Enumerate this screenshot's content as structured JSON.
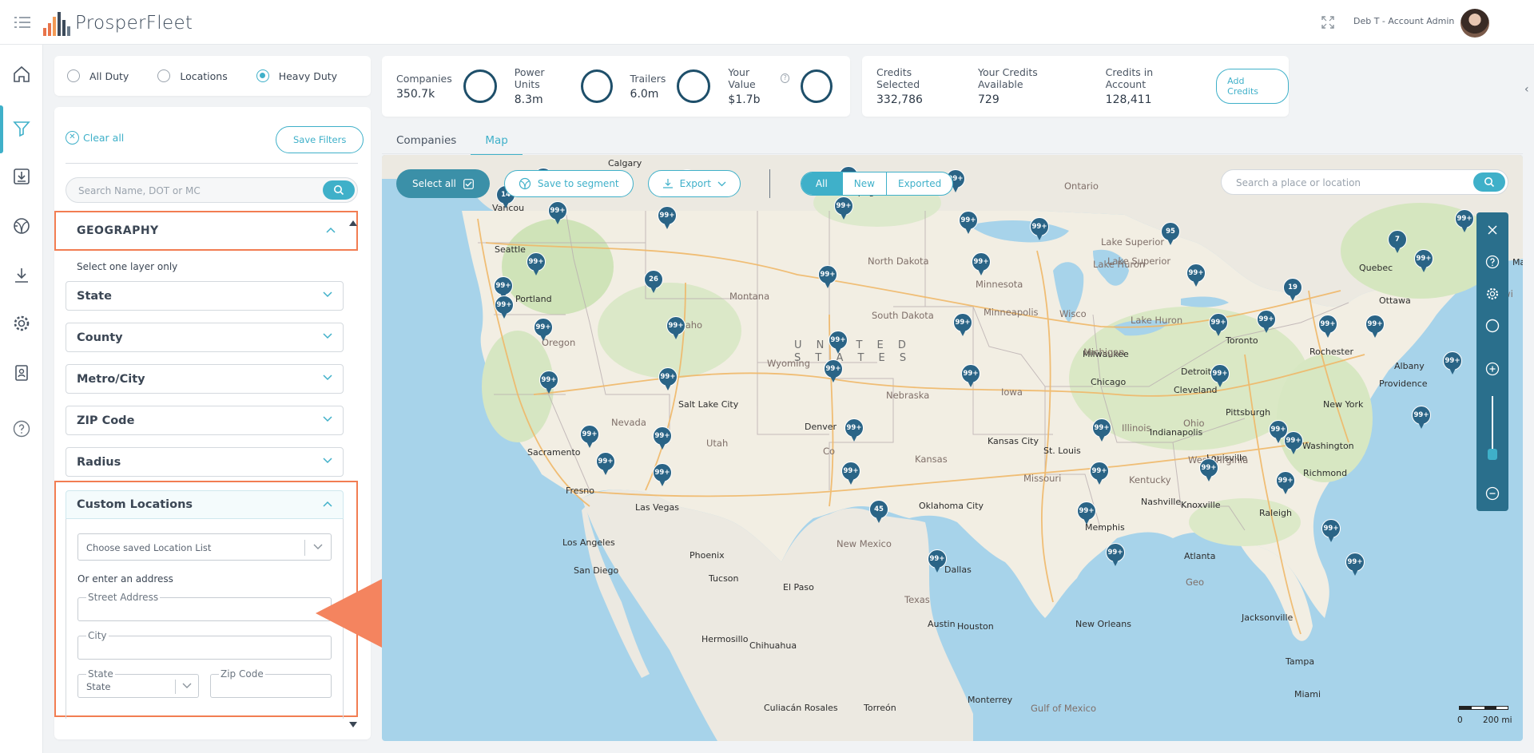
{
  "header": {
    "brand": "ProsperFleet",
    "user": "Deb T - Account Admin",
    "logo_colors": [
      "#e8744a",
      "#e8744a",
      "#f39a55",
      "#3c4a5a",
      "#3c4a5a",
      "#6a7a8a"
    ]
  },
  "duty": {
    "options": [
      "All Duty",
      "Locations",
      "Heavy Duty"
    ],
    "selected": "Heavy Duty"
  },
  "stats": [
    {
      "label": "Companies",
      "value": "350.7k"
    },
    {
      "label": "Power Units",
      "value": "8.3m"
    },
    {
      "label": "Trailers",
      "value": "6.0m"
    },
    {
      "label": "Your Value",
      "value": "$1.7b",
      "help": "?"
    }
  ],
  "credits": {
    "items": [
      {
        "label": "Credits Selected",
        "value": "332,786"
      },
      {
        "label": "Your Credits Available",
        "value": "729"
      },
      {
        "label": "Credits in Account",
        "value": "128,411"
      }
    ],
    "add_label": "Add Credits"
  },
  "filters": {
    "clear_label": "Clear all",
    "clear_icon": "✕",
    "save_label": "Save Filters",
    "search_placeholder": "Search Name, DOT or MC",
    "geography": "GEOGRAPHY",
    "layer_note": "Select one layer only",
    "sections": [
      "State",
      "County",
      "Metro/City",
      "ZIP Code",
      "Radius"
    ],
    "custom": {
      "title": "Custom Locations",
      "saved_list_placeholder": "Choose saved Location List",
      "or_address": "Or enter an address",
      "street_label": "Street Address",
      "city_label": "City",
      "state_label": "State",
      "state_value": "State",
      "zip_label": "Zip Code"
    }
  },
  "tabs": [
    "Companies",
    "Map"
  ],
  "active_tab": "Map",
  "map": {
    "select_all": "Select all",
    "save_segment": "Save to segment",
    "export": "Export",
    "segments": [
      "All",
      "New",
      "Exported"
    ],
    "active_segment": "All",
    "search_placeholder": "Search a place or location",
    "scale_labels": [
      "0",
      "200 mi"
    ],
    "country_label": [
      "U N I T E D",
      "S T A T E S"
    ],
    "places": [
      {
        "t": "Calgary"
      },
      {
        "t": "Vancou"
      },
      {
        "t": "Winnipeg"
      },
      {
        "t": "Ontario"
      },
      {
        "t": "Seattle"
      },
      {
        "t": "Portland"
      },
      {
        "t": "Montana"
      },
      {
        "t": "North Dakota"
      },
      {
        "t": "Minnesota"
      },
      {
        "t": "Lake Superior"
      },
      {
        "t": "Quebec"
      },
      {
        "t": "New Brunswi"
      },
      {
        "t": "Ottawa"
      },
      {
        "t": "Idaho"
      },
      {
        "t": "Oregon"
      },
      {
        "t": "South Dakota"
      },
      {
        "t": "Minneapolis"
      },
      {
        "t": "Wisco"
      },
      {
        "t": "Lake Huron"
      },
      {
        "t": "Toronto"
      },
      {
        "t": "Rochester"
      },
      {
        "t": "Milwaukee"
      },
      {
        "t": "Michigan"
      },
      {
        "t": "Wyoming"
      },
      {
        "t": "Albany"
      },
      {
        "t": "Detroit"
      },
      {
        "t": "Providence"
      },
      {
        "t": "Chicago"
      },
      {
        "t": "Iowa"
      },
      {
        "t": "Cleveland"
      },
      {
        "t": "Nebraska"
      },
      {
        "t": "Salt Lake City"
      },
      {
        "t": "New York"
      },
      {
        "t": "Pittsburgh"
      },
      {
        "t": "Nevada"
      },
      {
        "t": "Denver"
      },
      {
        "t": "Ohio"
      },
      {
        "t": "Indianapolis"
      },
      {
        "t": "Illinois"
      },
      {
        "t": "Utah"
      },
      {
        "t": "Kansas City"
      },
      {
        "t": "Sacramento"
      },
      {
        "t": "Washington"
      },
      {
        "t": "Kansas"
      },
      {
        "t": "St. Louis"
      },
      {
        "t": "Louisville"
      },
      {
        "t": "West Virginia"
      },
      {
        "t": "Co"
      },
      {
        "t": "Missouri"
      },
      {
        "t": "Richmond"
      },
      {
        "t": "Kentucky"
      },
      {
        "t": "Fresno"
      },
      {
        "t": "Las Vegas"
      },
      {
        "t": "Nashville"
      },
      {
        "t": "Knoxville"
      },
      {
        "t": "Oklahoma City"
      },
      {
        "t": "Raleigh"
      },
      {
        "t": "Memphis"
      },
      {
        "t": "Los Angeles"
      },
      {
        "t": "New Mexico"
      },
      {
        "t": "Phoenix"
      },
      {
        "t": "Atlanta"
      },
      {
        "t": "San Diego"
      },
      {
        "t": "Tucson"
      },
      {
        "t": "Geo"
      },
      {
        "t": "Dallas"
      },
      {
        "t": "El Paso"
      },
      {
        "t": "Texas"
      },
      {
        "t": "Jacksonville"
      },
      {
        "t": "New Orleans"
      },
      {
        "t": "Austin"
      },
      {
        "t": "Houston"
      },
      {
        "t": "Hermosillo"
      },
      {
        "t": "Chihuahua"
      },
      {
        "t": "Tampa"
      },
      {
        "t": "Miami"
      },
      {
        "t": "Monterrey"
      },
      {
        "t": "Culiacán Rosales"
      },
      {
        "t": "Torreón"
      },
      {
        "t": "Gulf of Mexico"
      },
      {
        "t": "MEXICO"
      },
      {
        "t": "Lake Superior"
      },
      {
        "t": "Lake Huron"
      },
      {
        "t": "Max"
      }
    ],
    "pins": [
      "99+",
      "48",
      "55",
      "99+",
      "14",
      "99+",
      "99+",
      "99+",
      "99+",
      "99+",
      "95",
      "7",
      "99+",
      "99+",
      "99+",
      "99+",
      "99+",
      "99+",
      "26",
      "19",
      "99+",
      "99+",
      "99+",
      "99+",
      "99+",
      "99+",
      "99+",
      "99+",
      "99+",
      "99+",
      "99+",
      "99+",
      "99+",
      "99+",
      "99+",
      "99+",
      "99+",
      "99+",
      "99+",
      "99+",
      "99+",
      "99+",
      "99+",
      "99+",
      "99+",
      "99+",
      "99+",
      "99+",
      "45",
      "99+",
      "99+",
      "99+",
      "99+",
      "99+",
      "99+"
    ]
  }
}
